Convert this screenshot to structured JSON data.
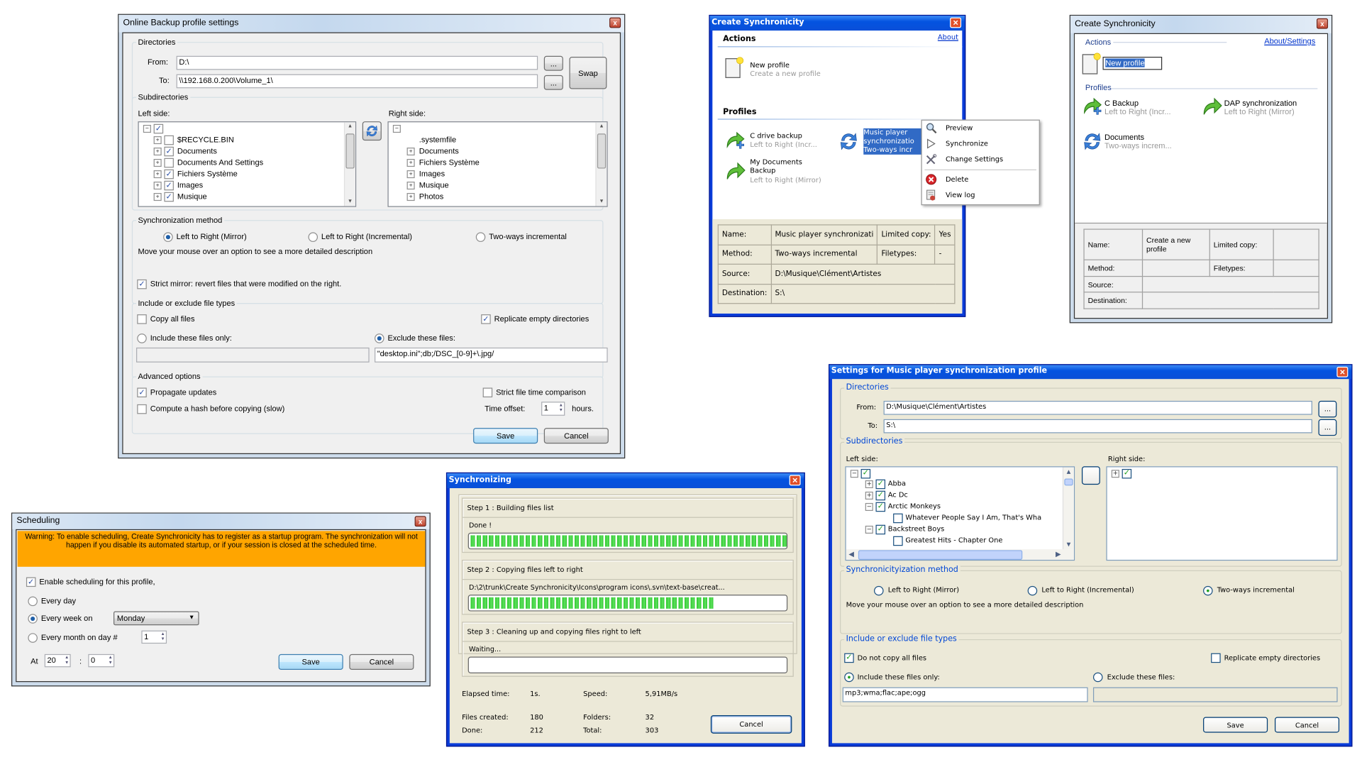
{
  "backup_window": {
    "title": "Online Backup profile settings",
    "close_glyph": "x",
    "directories": {
      "label": "Directories",
      "from_label": "From:",
      "from_value": "D:\\",
      "to_label": "To:",
      "to_value": "\\\\192.168.0.200\\Volume_1\\",
      "browse_label": "...",
      "swap_label": "Swap"
    },
    "subdirectories": {
      "label": "Subdirectories",
      "left_label": "Left side:",
      "right_label": "Right side:",
      "left_root_checked": true,
      "left_items": [
        {
          "label": "$RECYCLE.BIN",
          "checked": false
        },
        {
          "label": "Documents",
          "checked": true
        },
        {
          "label": "Documents And Settings",
          "checked": false
        },
        {
          "label": "Fichiers Système",
          "checked": true
        },
        {
          "label": "Images",
          "checked": true
        },
        {
          "label": "Musique",
          "checked": true
        }
      ],
      "right_items": [
        ".systemfile",
        "Documents",
        "Fichiers Système",
        "Images",
        "Musique",
        "Photos"
      ]
    },
    "sync_method": {
      "label": "Synchronization method",
      "options": [
        "Left to Right (Mirror)",
        "Left to Right (Incremental)",
        "Two-ways incremental"
      ],
      "selected": [
        true,
        false,
        false
      ],
      "hint": "Move your mouse over an option to see a more detailed description",
      "strict_mirror_label": "Strict mirror: revert files that were modified on the right.",
      "strict_mirror_checked": true
    },
    "file_types": {
      "label": "Include or exclude file types",
      "copy_all_label": "Copy all files",
      "copy_all_checked": false,
      "replicate_label": "Replicate empty directories",
      "replicate_checked": true,
      "include_label": "Include these files only:",
      "include_selected": false,
      "include_value": "",
      "exclude_label": "Exclude these files:",
      "exclude_selected": true,
      "exclude_value": "\"desktop.ini\";db;/DSC_[0-9]+\\.jpg/"
    },
    "advanced": {
      "label": "Advanced options",
      "propagate_label": "Propagate updates",
      "propagate_checked": true,
      "strict_time_label": "Strict file time comparison",
      "strict_time_checked": false,
      "hash_label": "Compute a hash before copying (slow)",
      "hash_checked": false,
      "time_offset_label": "Time offset:",
      "time_offset_value": "1",
      "hours_label": "hours."
    },
    "save_label": "Save",
    "cancel_label": "Cancel"
  },
  "main_xp_window": {
    "title": "Create Synchronicity",
    "actions_label": "Actions",
    "about_label": "About",
    "new_profile_label": "New profile",
    "new_profile_sub": "Create a new profile",
    "profiles_label": "Profiles",
    "profiles": [
      {
        "name": "C drive backup",
        "sub": "Left to Right (Incr...",
        "icon": "green-arrow-plus"
      },
      {
        "name_lines": [
          "Music player",
          "synchronizatio",
          "Two-ways incr"
        ],
        "icon": "blue-sync",
        "selected": true
      },
      {
        "name_lines": [
          "My Documents",
          "Backup"
        ],
        "sub": "Left to Right (Mirror)",
        "icon": "green-arrow"
      }
    ],
    "info": {
      "name_label": "Name:",
      "name_value": "Music player synchronizati",
      "limited_label": "Limited copy:",
      "limited_value": "Yes",
      "method_label": "Method:",
      "method_value": "Two-ways incremental",
      "filetypes_label": "Filetypes:",
      "filetypes_value": "-",
      "source_label": "Source:",
      "source_value": "D:\\Musique\\Clément\\Artistes",
      "dest_label": "Destination:",
      "dest_value": "S:\\"
    }
  },
  "context_menu": {
    "items": [
      {
        "label": "Preview",
        "icon": "magnifier"
      },
      {
        "label": "Synchronize",
        "icon": "play"
      },
      {
        "label": "Change Settings",
        "icon": "tools"
      },
      {
        "label": "Delete",
        "icon": "red-x"
      },
      {
        "label": "View log",
        "icon": "log"
      }
    ]
  },
  "main_vista_window": {
    "title": "Create Synchronicity",
    "actions_label": "Actions",
    "about_label": "About/Settings",
    "new_profile_input": "New profile",
    "profiles_label": "Profiles",
    "profiles": [
      {
        "name": "C Backup",
        "sub": "Left to Right (Incr...",
        "icon": "green-arrow-plus"
      },
      {
        "name": "DAP synchronization",
        "sub": "Left to Right (Mirror)",
        "icon": "green-arrow"
      },
      {
        "name": "Documents",
        "sub": "Two-ways increm...",
        "icon": "blue-sync"
      }
    ],
    "info": {
      "name_label": "Name:",
      "name_value": "Create a new profile",
      "limited_label": "Limited copy:",
      "method_label": "Method:",
      "filetypes_label": "Filetypes:",
      "source_label": "Source:",
      "dest_label": "Destination:"
    }
  },
  "scheduling_window": {
    "title": "Scheduling",
    "warning": "Warning: To enable scheduling, Create Synchronicity has to register as a startup program. The synchronization will not happen if you disable its automated startup, or if your session is closed at the scheduled time.",
    "warning_color": "#ffa500",
    "enable_label": "Enable scheduling for this profile,",
    "enable_checked": true,
    "every_day_label": "Every day",
    "every_day_selected": false,
    "every_week_label": "Every week on",
    "every_week_selected": true,
    "weekday_value": "Monday",
    "every_month_label": "Every month on day #",
    "every_month_selected": false,
    "month_day_value": "1",
    "at_label": "At",
    "hour_value": "20",
    "colon": ":",
    "minute_value": "0",
    "save_label": "Save",
    "cancel_label": "Cancel"
  },
  "sync_window": {
    "title": "Synchronizing",
    "steps": [
      {
        "title": "Step 1 : Building files list",
        "status": "Done !",
        "progress": 100
      },
      {
        "title": "Step 2 : Copying files left to right",
        "status": "D:\\2\\trunk\\Create Synchronicity\\Icons\\program icons\\.svn\\text-base\\creat...",
        "progress": 77
      },
      {
        "title": "Step 3 : Cleaning up and copying files right to left",
        "status": "Waiting...",
        "progress": 0
      }
    ],
    "stats": {
      "elapsed_label": "Elapsed time:",
      "elapsed_value": "1s.",
      "speed_label": "Speed:",
      "speed_value": "5,91MB/s",
      "created_label": "Files created:",
      "created_value": "180",
      "folders_label": "Folders:",
      "folders_value": "32",
      "done_label": "Done:",
      "done_value": "212",
      "total_label": "Total:",
      "total_value": "303"
    },
    "cancel_label": "Cancel"
  },
  "settings_window": {
    "title": "Settings for Music player synchronization profile",
    "directories": {
      "label": "Directories",
      "from_label": "From:",
      "from_value": "D:\\Musique\\Clément\\Artistes",
      "to_label": "To:",
      "to_value": "S:\\",
      "browse_label": "..."
    },
    "subdirectories": {
      "label": "Subdirectories",
      "left_label": "Left side:",
      "right_label": "Right side:",
      "left_items": [
        {
          "label": "Abba",
          "checked": true,
          "level": 1,
          "exp": "+"
        },
        {
          "label": "Ac  Dc",
          "checked": true,
          "level": 1,
          "exp": "+"
        },
        {
          "label": "Arctic Monkeys",
          "checked": true,
          "level": 1,
          "exp": "−"
        },
        {
          "label": "Whatever People Say I Am, That's Wha",
          "checked": false,
          "level": 2
        },
        {
          "label": "Backstreet Boys",
          "checked": true,
          "level": 1,
          "exp": "−"
        },
        {
          "label": "Greatest Hits - Chapter One",
          "checked": false,
          "level": 2
        }
      ]
    },
    "sync_method": {
      "label": "Synchronicityization method",
      "options": [
        "Left to Right (Mirror)",
        "Left to Right (Incremental)",
        "Two-ways incremental"
      ],
      "selected": [
        false,
        false,
        true
      ],
      "hint": "Move your mouse over an option to see a more detailed description"
    },
    "file_types": {
      "label": "Include or exclude file types",
      "no_copy_all_label": "Do not copy all files",
      "no_copy_all_checked": true,
      "replicate_label": "Replicate empty directories",
      "replicate_checked": false,
      "include_label": "Include these files only:",
      "include_selected": true,
      "include_value": "mp3;wma;flac;ape;ogg",
      "exclude_label": "Exclude these files:",
      "exclude_selected": false,
      "exclude_value": ""
    },
    "save_label": "Save",
    "cancel_label": "Cancel"
  }
}
